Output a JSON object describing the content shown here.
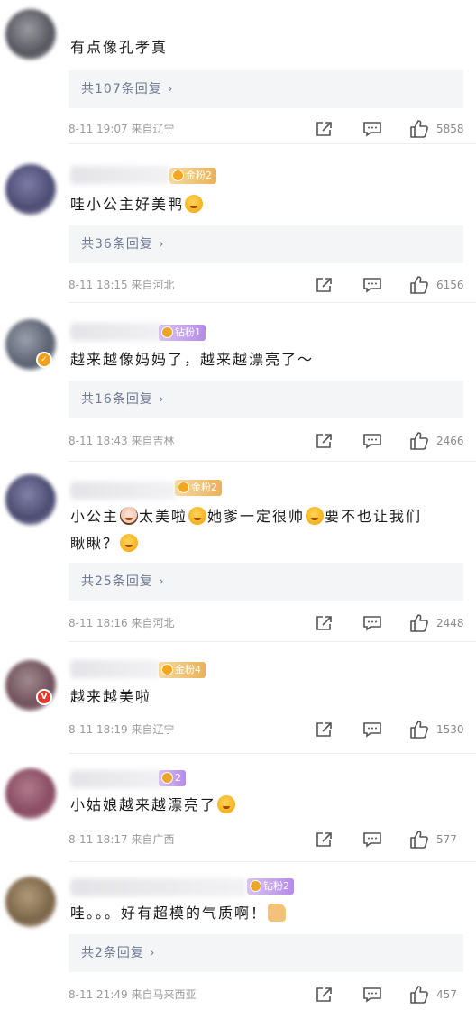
{
  "comments": [
    {
      "text": "有点像孔孝真",
      "reply_label": "共107条回复",
      "time_location": "8-11 19:07 来自辽宁",
      "likes": "5858"
    },
    {
      "fan_badge": "金粉2",
      "text": "哇小公主好美鸭",
      "reply_label": "共36条回复",
      "time_location": "8-11 18:15 来自河北",
      "likes": "6156"
    },
    {
      "fan_badge": "钻粉1",
      "text": "越来越像妈妈了，越来越漂亮了～",
      "reply_label": "共16条回复",
      "time_location": "8-11 18:43 来自吉林",
      "likes": "2466"
    },
    {
      "fan_badge": "金粉2",
      "text_a": "小公主",
      "text_b": "太美啦",
      "text_c": "她爹一定很帅",
      "text_d": "要不也让我们",
      "text_e": "瞅瞅？",
      "reply_label": "共25条回复",
      "time_location": "8-11 18:16 来自河北",
      "likes": "2448"
    },
    {
      "fan_badge": "金粉4",
      "text": "越来越美啦",
      "time_location": "8-11 18:19 来自辽宁",
      "likes": "1530"
    },
    {
      "fan_badge": "2",
      "text": "小姑娘越来越漂亮了",
      "time_location": "8-11 18:17 来自广西",
      "likes": "577"
    },
    {
      "fan_badge": "钻粉2",
      "text": "哇。。。好有超模的气质啊！",
      "reply_label": "共2条回复",
      "time_location": "8-11 21:49 来自马来西亚",
      "likes": "457"
    }
  ],
  "icons": {
    "share": "share-icon",
    "reply": "comment-icon",
    "like": "thumbs-up-icon",
    "chevron": "chevron-right-icon"
  },
  "colors": {
    "reply_text": "#6f7c95",
    "reply_bg": "#f4f5f7",
    "gold_badge": "#e9b257",
    "diamond_badge": "#b58be6"
  }
}
